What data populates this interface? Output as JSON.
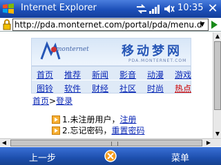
{
  "titlebar": {
    "app_name": "Internet Explorer",
    "time": "10:35",
    "close_glyph": "✕"
  },
  "address": {
    "url": "http://pda.monternet.com/portal/pda/menu.d"
  },
  "page": {
    "logo_text": "monternet",
    "brand_cn": "移动梦网",
    "brand_en": "PDA.MONTERNET.COM",
    "nav_row1": [
      "首页",
      "推荐",
      "新闻",
      "影音",
      "动漫",
      "游戏"
    ],
    "nav_row2": [
      "图铃",
      "软件",
      "财经",
      "社区",
      "时尚",
      "热点"
    ],
    "breadcrumb_home": "首页",
    "breadcrumb_sep": ">",
    "breadcrumb_current": "登录",
    "line1_prefix": "1.未注册用户，",
    "line1_link": "注册",
    "line2_prefix": "2.忘记密码，",
    "line2_link": "重置密码"
  },
  "softkeys": {
    "left": "上一步",
    "right": "菜单"
  },
  "colors": {
    "titlebar": "#1c4fb8",
    "link": "#0b28b6",
    "hot_link": "#cc0000"
  }
}
